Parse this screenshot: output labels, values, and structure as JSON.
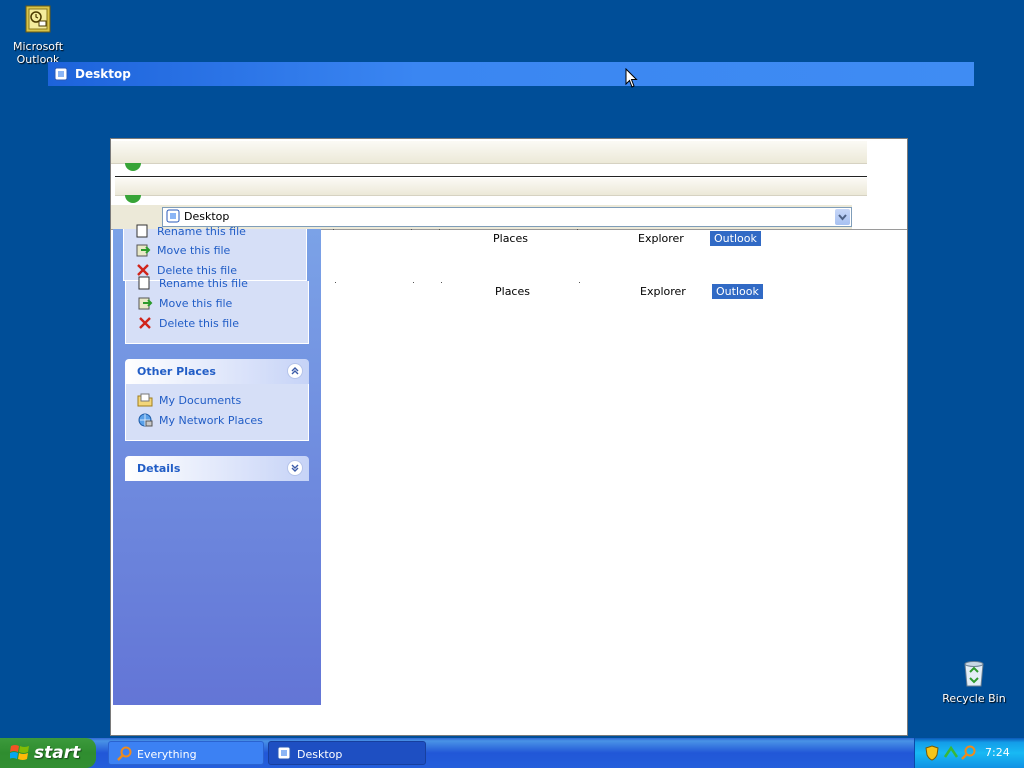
{
  "desktop": {
    "icons": [
      {
        "label_line1": "Microsoft",
        "label_line2": "Outlook",
        "icon": "outlook-icon"
      },
      {
        "label_line1": "Recycle Bin",
        "icon": "recycle-bin-icon"
      }
    ]
  },
  "drag_window": {
    "title": "Desktop",
    "icon": "desktop-folder-icon"
  },
  "window": {
    "address": {
      "value": "Desktop",
      "icon": "desktop-folder-icon"
    },
    "task_pane": {
      "file_tasks": [
        {
          "label": "Rename this file",
          "icon": "rename-icon"
        },
        {
          "label": "Move this file",
          "icon": "move-icon"
        },
        {
          "label": "Delete this file",
          "icon": "delete-icon"
        },
        {
          "label": "Rename this file",
          "icon": "rename-icon"
        },
        {
          "label": "Move this file",
          "icon": "move-icon"
        },
        {
          "label": "Delete this file",
          "icon": "delete-icon"
        }
      ],
      "other_places": {
        "title": "Other Places",
        "items": [
          {
            "label": "My Documents",
            "icon": "my-documents-icon"
          },
          {
            "label": "My Network Places",
            "icon": "network-places-icon"
          }
        ]
      },
      "details": {
        "title": "Details"
      }
    },
    "content_rows": [
      {
        "col1": "Places",
        "col2": "Explorer",
        "col3": "Outlook"
      },
      {
        "col1": "Places",
        "col2": "Explorer",
        "col3": "Outlook"
      }
    ]
  },
  "taskbar": {
    "start_label": "start",
    "buttons": [
      {
        "label": "Everything",
        "icon": "search-icon"
      },
      {
        "label": "Desktop",
        "icon": "desktop-folder-icon"
      }
    ],
    "clock": "7:24",
    "colors": {
      "accent": "#245edb",
      "tray": "#18b9f4",
      "desktop": "#004e98"
    }
  }
}
